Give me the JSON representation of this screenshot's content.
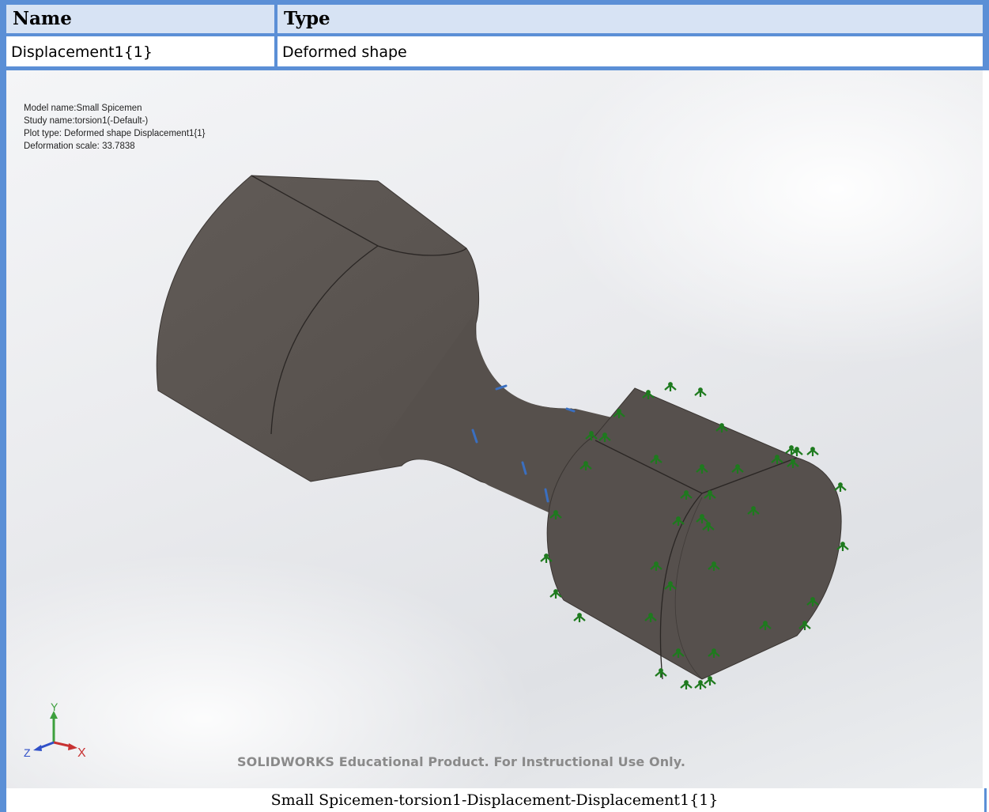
{
  "table": {
    "headers": [
      "Name",
      "Type"
    ],
    "row": [
      "Displacement1{1}",
      "Deformed shape"
    ]
  },
  "plot": {
    "info_lines": [
      "Model name:Small Spicemen",
      "Study name:torsion1(-Default-)",
      "Plot type: Deformed shape Displacement1{1}",
      "Deformation scale: 33.7838"
    ],
    "triad": {
      "x": "X",
      "y": "Y",
      "z": "Z"
    },
    "watermark": "SOLIDWORKS Educational Product. For Instructional Use Only.",
    "fixture_color": "#1e7a1e",
    "load_color": "#3a6fc0",
    "model_color": "#58524e"
  },
  "caption": "Small Spicemen-torsion1-Displacement-Displacement1{1}"
}
